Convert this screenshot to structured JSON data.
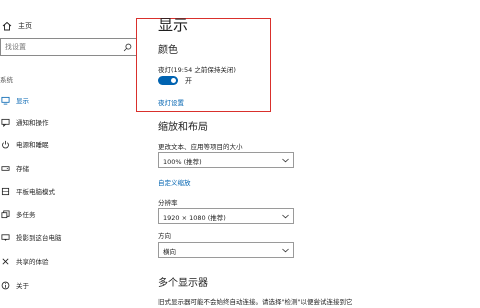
{
  "sidebar": {
    "home_label": "主页",
    "search_placeholder": "找设置",
    "section_label": "系统",
    "items": [
      {
        "label": "显示",
        "icon": "monitor-icon",
        "active": true
      },
      {
        "label": "通知和操作",
        "icon": "message-icon",
        "active": false
      },
      {
        "label": "电源和睡眠",
        "icon": "power-icon",
        "active": false
      },
      {
        "label": "存储",
        "icon": "storage-icon",
        "active": false
      },
      {
        "label": "平板电脑模式",
        "icon": "tablet-icon",
        "active": false
      },
      {
        "label": "多任务",
        "icon": "multitask-icon",
        "active": false
      },
      {
        "label": "投影到这台电脑",
        "icon": "project-icon",
        "active": false
      },
      {
        "label": "共享的体验",
        "icon": "share-icon",
        "active": false
      },
      {
        "label": "关于",
        "icon": "info-icon",
        "active": false
      }
    ]
  },
  "main": {
    "title": "显示",
    "color": {
      "heading": "颜色",
      "night_light_label": "夜灯(19:54 之前保持关闭)",
      "toggle_state": "开",
      "settings_link": "夜灯设置"
    },
    "scale_layout": {
      "heading": "缩放和布局",
      "scale_label": "更改文本、应用等项目的大小",
      "scale_value": "100% (推荐)",
      "custom_scale_link": "自定义缩放",
      "resolution_label": "分辨率",
      "resolution_value": "1920 × 1080 (推荐)",
      "orientation_label": "方向",
      "orientation_value": "横向"
    },
    "multiple_displays": {
      "heading": "多个显示器",
      "description": "旧式显示器可能不会始终自动连接。请选择\"检测\"以便尝试连接到它"
    }
  },
  "colors": {
    "accent": "#0063b1",
    "highlight_border": "#d9302c"
  }
}
